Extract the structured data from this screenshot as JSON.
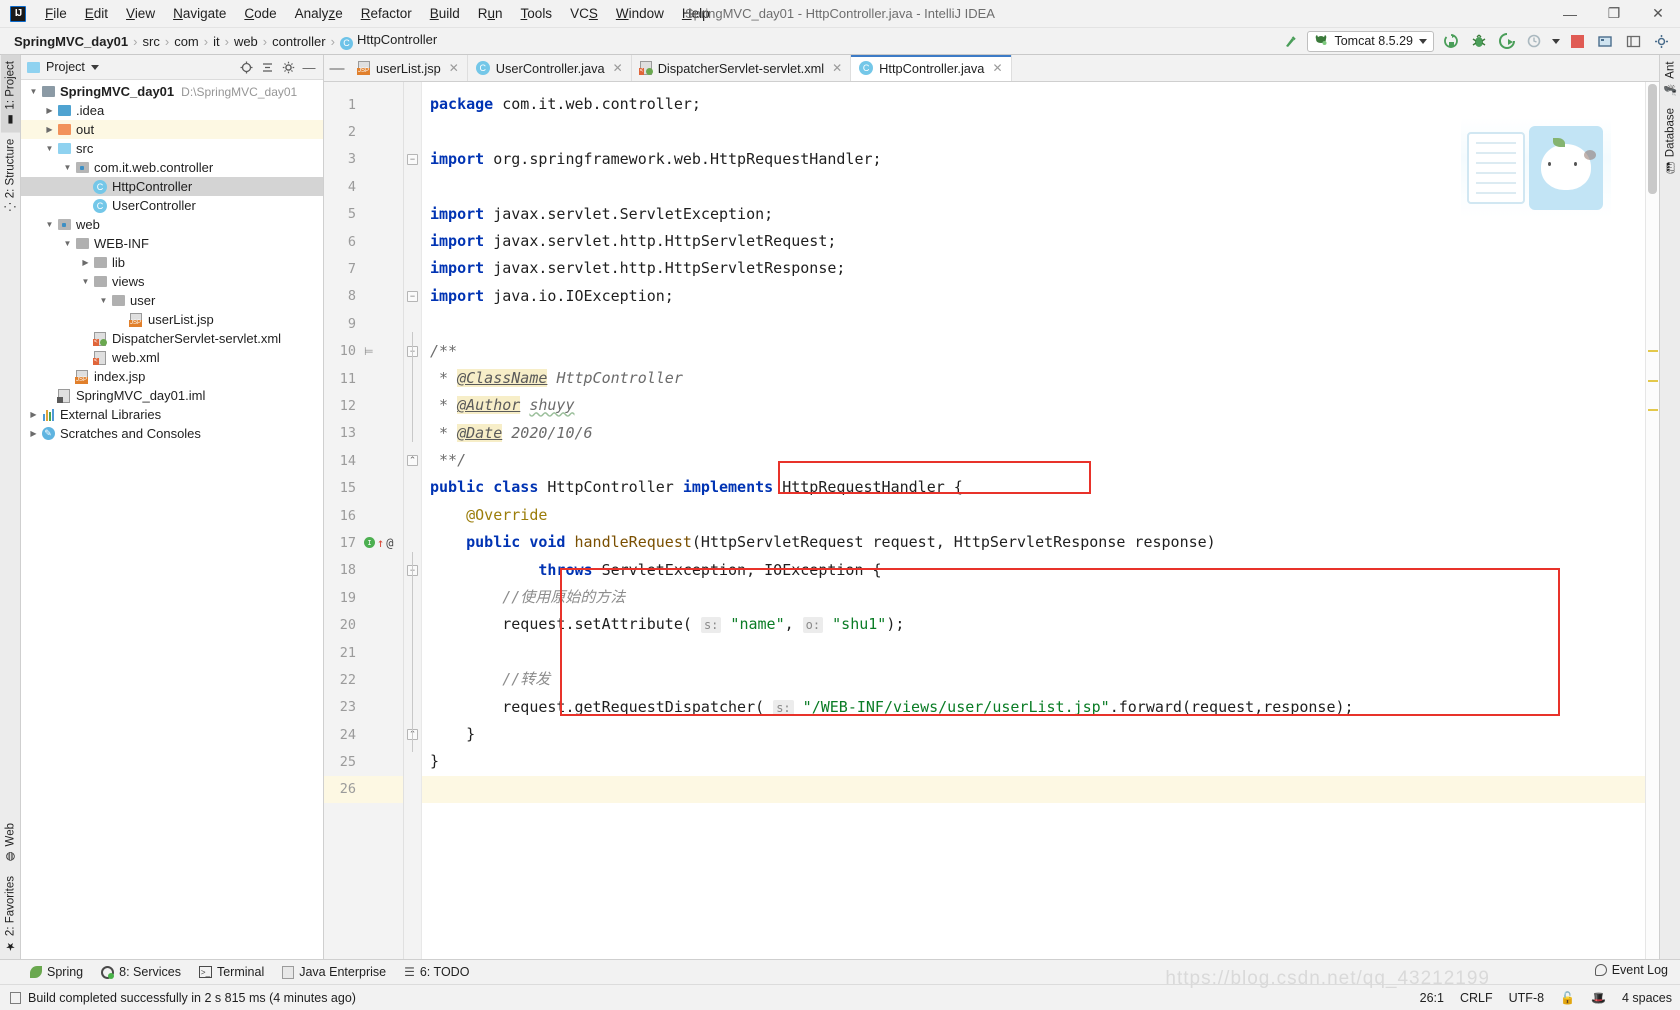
{
  "window": {
    "title": "SpringMVC_day01 - HttpController.java - IntelliJ IDEA",
    "minimize": "—",
    "maximize": "❐",
    "close": "✕"
  },
  "menu": {
    "items": [
      {
        "label": "File"
      },
      {
        "label": "Edit"
      },
      {
        "label": "View"
      },
      {
        "label": "Navigate"
      },
      {
        "label": "Code"
      },
      {
        "label": "Analyze"
      },
      {
        "label": "Refactor"
      },
      {
        "label": "Build"
      },
      {
        "label": "Run"
      },
      {
        "label": "Tools"
      },
      {
        "label": "VCS"
      },
      {
        "label": "Window"
      },
      {
        "label": "Help"
      }
    ]
  },
  "breadcrumb": {
    "items": [
      "SpringMVC_day01",
      "src",
      "com",
      "it",
      "web",
      "controller",
      "HttpController"
    ],
    "separator": "›",
    "class_icon_letter": "C"
  },
  "toolbar": {
    "build_label": "↖",
    "run_config": "Tomcat 8.5.29",
    "run_label": "▶",
    "debug_label": "🐞",
    "coverage_label": "▶",
    "profile_label": "◴",
    "stop_label": "■",
    "search_label": "🔍",
    "settings_label": "⚙",
    "layout_label": "❐"
  },
  "left_strip": {
    "tabs": [
      {
        "label": "1: Project",
        "selected": true,
        "icon": "folder-icon"
      },
      {
        "label": "2: Structure",
        "selected": false,
        "icon": "structure-icon"
      },
      {
        "label": "Web",
        "selected": false,
        "icon": "globe-icon"
      },
      {
        "label": "2: Favorites",
        "selected": false,
        "icon": "star-icon"
      }
    ]
  },
  "right_strip": {
    "tabs": [
      {
        "label": "Ant",
        "icon": "ant-icon"
      },
      {
        "label": "Database",
        "icon": "database-icon"
      }
    ]
  },
  "project_panel": {
    "title": "Project",
    "dropdown_caret": "▾",
    "actions": [
      "locate-icon",
      "collapse-all-icon",
      "settings-icon",
      "hide-icon"
    ],
    "tree": [
      {
        "indent": 0,
        "arrow": "▼",
        "icon": "module-icon",
        "label": "SpringMVC_day01",
        "bold": true,
        "path": "D:\\SpringMVC_day01",
        "state": "normal"
      },
      {
        "indent": 1,
        "arrow": "▶",
        "icon": "folder-icon",
        "label": ".idea",
        "state": "normal"
      },
      {
        "indent": 1,
        "arrow": "▶",
        "icon": "folder-orange-icon",
        "label": "out",
        "state": "highlight"
      },
      {
        "indent": 1,
        "arrow": "▼",
        "icon": "folder-source-icon",
        "label": "src",
        "state": "normal"
      },
      {
        "indent": 2,
        "arrow": "▼",
        "icon": "package-icon",
        "label": "com.it.web.controller",
        "state": "normal"
      },
      {
        "indent": 3,
        "arrow": "",
        "icon": "class-icon",
        "label": "HttpController",
        "state": "selected"
      },
      {
        "indent": 3,
        "arrow": "",
        "icon": "class-icon",
        "label": "UserController",
        "state": "normal"
      },
      {
        "indent": 1,
        "arrow": "▼",
        "icon": "web-folder-icon",
        "label": "web",
        "state": "normal"
      },
      {
        "indent": 2,
        "arrow": "▼",
        "icon": "folder-icon",
        "label": "WEB-INF",
        "state": "normal"
      },
      {
        "indent": 3,
        "arrow": "▶",
        "icon": "folder-icon",
        "label": "lib",
        "state": "normal"
      },
      {
        "indent": 3,
        "arrow": "▼",
        "icon": "folder-icon",
        "label": "views",
        "state": "normal"
      },
      {
        "indent": 4,
        "arrow": "▼",
        "icon": "folder-icon",
        "label": "user",
        "state": "normal"
      },
      {
        "indent": 5,
        "arrow": "",
        "icon": "jsp-file-icon",
        "label": "userList.jsp",
        "state": "normal"
      },
      {
        "indent": 3,
        "arrow": "",
        "icon": "xml-ok-file-icon",
        "label": "DispatcherServlet-servlet.xml",
        "state": "normal"
      },
      {
        "indent": 3,
        "arrow": "",
        "icon": "xml-file-icon",
        "label": "web.xml",
        "state": "normal"
      },
      {
        "indent": 2,
        "arrow": "",
        "icon": "jsp-file-icon",
        "label": "index.jsp",
        "state": "normal"
      },
      {
        "indent": 1,
        "arrow": "",
        "icon": "iml-file-icon",
        "label": "SpringMVC_day01.iml",
        "state": "normal"
      },
      {
        "indent": 0,
        "arrow": "▶",
        "icon": "libraries-icon",
        "label": "External Libraries",
        "state": "normal"
      },
      {
        "indent": 0,
        "arrow": "▶",
        "icon": "scratches-icon",
        "label": "Scratches and Consoles",
        "state": "normal"
      }
    ]
  },
  "editor": {
    "collapse_icon": "—",
    "tabs": [
      {
        "label": "userList.jsp",
        "icon": "jsp-file-icon",
        "active": false,
        "close": "✕"
      },
      {
        "label": "UserController.java",
        "icon": "class-icon",
        "active": false,
        "close": "✕"
      },
      {
        "label": "DispatcherServlet-servlet.xml",
        "icon": "xml-ok-file-icon",
        "active": false,
        "close": "✕"
      },
      {
        "label": "HttpController.java",
        "icon": "class-icon",
        "active": true,
        "close": "✕"
      }
    ],
    "line_numbers": [
      1,
      2,
      3,
      4,
      5,
      6,
      7,
      8,
      9,
      10,
      11,
      12,
      13,
      14,
      15,
      16,
      17,
      18,
      19,
      20,
      21,
      22,
      23,
      24,
      25,
      26
    ],
    "gutter_marks": {
      "override_line": 17,
      "override_icon": "override-method-icon",
      "override_arrow": "↑",
      "at_symbol": "@",
      "javadoc_line": 10,
      "javadoc_icon": "doc-lines-icon"
    },
    "code_lines": [
      {
        "n": 1,
        "text": "package com.it.web.controller;"
      },
      {
        "n": 2,
        "text": ""
      },
      {
        "n": 3,
        "text": "import org.springframework.web.HttpRequestHandler;"
      },
      {
        "n": 4,
        "text": ""
      },
      {
        "n": 5,
        "text": "import javax.servlet.ServletException;"
      },
      {
        "n": 6,
        "text": "import javax.servlet.http.HttpServletRequest;"
      },
      {
        "n": 7,
        "text": "import javax.servlet.http.HttpServletResponse;"
      },
      {
        "n": 8,
        "text": "import java.io.IOException;"
      },
      {
        "n": 9,
        "text": ""
      },
      {
        "n": 10,
        "text": "/**"
      },
      {
        "n": 11,
        "text": " * @ClassName HttpController"
      },
      {
        "n": 12,
        "text": " * @Author shuyy"
      },
      {
        "n": 13,
        "text": " * @Date 2020/10/6"
      },
      {
        "n": 14,
        "text": " **/"
      },
      {
        "n": 15,
        "text": "public class HttpController implements HttpRequestHandler {"
      },
      {
        "n": 16,
        "text": "    @Override"
      },
      {
        "n": 17,
        "text": "    public void handleRequest(HttpServletRequest request, HttpServletResponse response)"
      },
      {
        "n": 18,
        "text": "            throws ServletException, IOException {"
      },
      {
        "n": 19,
        "text": "        //使用原始的方法"
      },
      {
        "n": 20,
        "text": "        request.setAttribute( s: \"name\", o: \"shu1\");"
      },
      {
        "n": 21,
        "text": ""
      },
      {
        "n": 22,
        "text": "        //转发"
      },
      {
        "n": 23,
        "text": "        request.getRequestDispatcher( s: \"/WEB-INF/views/user/userList.jsp\").forward(request,response);"
      },
      {
        "n": 24,
        "text": "    }"
      },
      {
        "n": 25,
        "text": "}"
      },
      {
        "n": 26,
        "text": ""
      }
    ],
    "tokens": {
      "kw_package": "package",
      "kw_import": "import",
      "kw_public": "public",
      "kw_class": "class",
      "kw_void": "void",
      "kw_implements": "implements",
      "kw_throws": "throws",
      "pkg_name": "com.it.web.controller;",
      "imp1": "org.springframework.web.HttpRequestHandler;",
      "imp2": "javax.servlet.ServletException;",
      "imp3": "javax.servlet.http.HttpServletRequest;",
      "imp4": "javax.servlet.http.HttpServletResponse;",
      "imp5": "java.io.IOException;",
      "doc_open": "/**",
      "doc_close": " **/",
      "doc_star": " * ",
      "tag_classname": "@ClassName",
      "val_classname": "HttpController",
      "tag_author": "@Author",
      "val_author": "shuyy",
      "tag_date": "@Date",
      "val_date": "2020/10/6",
      "class_name": "HttpController",
      "iface_name": "HttpRequestHandler {",
      "annotation_override": "@Override",
      "method_sig_a": "    ",
      "method_name": "handleRequest",
      "method_params": "(HttpServletRequest request, HttpServletResponse response)",
      "throws_clause": "ServletException, IOException {",
      "comment_raw": "//使用原始的方法",
      "call1_pre": "request.setAttribute( ",
      "hint_s": "s:",
      "str_name": "\"name\"",
      "hint_o": "o:",
      "str_shu1": "\"shu1\"",
      "call1_post": ");",
      "comment_forward": "//转发",
      "call2_pre": "request.getRequestDispatcher( ",
      "str_path": "\"/WEB-INF/views/user/userList.jsp\"",
      "call2_post": ".forward(request,response);",
      "close_brace_inner": "    }",
      "close_brace_outer": "}"
    }
  },
  "bottom_strip": {
    "items": [
      {
        "label": "Spring",
        "icon": "spring-leaf-icon",
        "shortcut": ""
      },
      {
        "label": "8: Services",
        "icon": "services-icon",
        "shortcut": "8"
      },
      {
        "label": "Terminal",
        "icon": "terminal-icon",
        "shortcut": ""
      },
      {
        "label": "Java Enterprise",
        "icon": "java-enterprise-icon",
        "shortcut": ""
      },
      {
        "label": "6: TODO",
        "icon": "todo-icon",
        "shortcut": "6"
      }
    ]
  },
  "status_bar": {
    "message": "Build completed successfully in 2 s 815 ms (4 minutes ago)",
    "message_icon": "build-message-icon",
    "event_log": "Event Log",
    "event_log_icon": "event-log-icon",
    "caret_position": "26:1",
    "line_separator": "CRLF",
    "encoding": "UTF-8",
    "lock_icon": "🔓",
    "inspection_icon": "🎩",
    "indent": "4 spaces",
    "watermark": "https://blog.csdn.net/qq_43212199"
  },
  "colors": {
    "accent_blue": "#3d7bc6",
    "keyword_blue": "#0033b3",
    "string_green": "#0a7c25",
    "annotation_red": "#e8322a",
    "highlight_yellow": "#fdf8e3",
    "tag_yellow": "#f7eec8",
    "selection_grey": "#d4d4d4",
    "stop_red": "#e05b54"
  }
}
